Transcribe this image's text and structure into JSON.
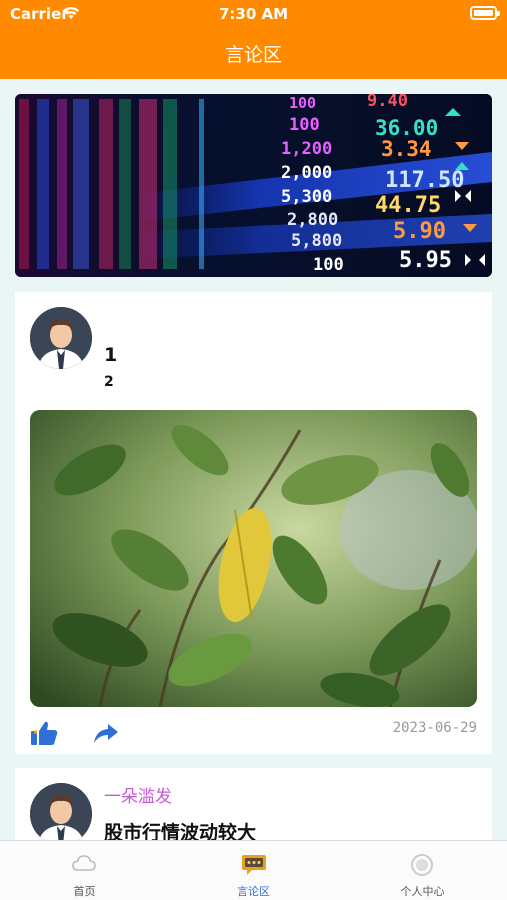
{
  "status_bar": {
    "carrier": "Carrier",
    "time": "7:30 AM"
  },
  "header": {
    "title": "言论区"
  },
  "banner": {
    "image": "stock-ticker-board"
  },
  "posts": [
    {
      "avatar": "person-avatar",
      "title": "1",
      "content": "2",
      "image": "green-leaves-photo",
      "date": "2023-06-29",
      "actions": {
        "like_icon": "thumbs-up-icon",
        "share_icon": "share-arrow-icon"
      }
    },
    {
      "avatar": "person-avatar",
      "author": "一朵滥发",
      "title": "股市行情波动较大"
    }
  ],
  "tabbar": {
    "items": [
      {
        "label": "首页",
        "icon": "cloud-icon",
        "active": false
      },
      {
        "label": "言论区",
        "icon": "chat-icon",
        "active": true
      },
      {
        "label": "个人中心",
        "icon": "user-circle-icon",
        "active": false
      }
    ]
  },
  "colors": {
    "accent": "#ff8a00",
    "active_tab": "#2f6fd6",
    "author": "#c85ad8",
    "like": "#2f6fd6"
  }
}
